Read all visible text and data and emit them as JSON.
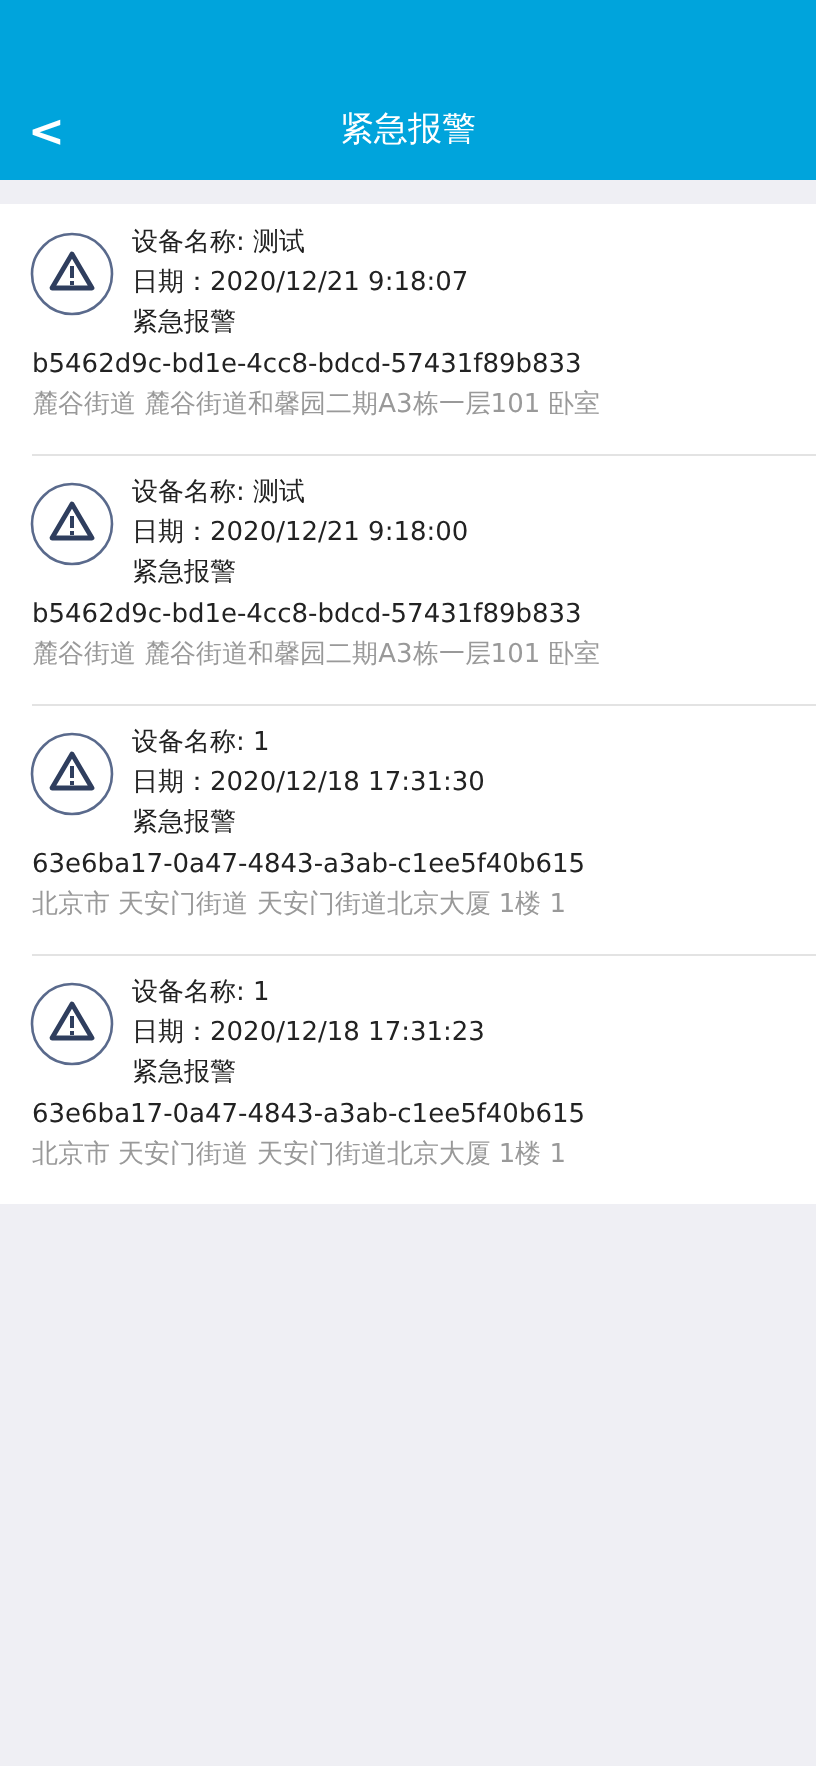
{
  "header": {
    "back": "<",
    "title": "紧急报警"
  },
  "alarms": [
    {
      "device": "设备名称: 测试",
      "date": "日期：2020/12/21 9:18:07",
      "type": "紧急报警",
      "id": "b5462d9c-bd1e-4cc8-bdcd-57431f89b833",
      "address": "麓谷街道 麓谷街道和馨园二期A3栋一层101 卧室"
    },
    {
      "device": "设备名称: 测试",
      "date": "日期：2020/12/21 9:18:00",
      "type": "紧急报警",
      "id": "b5462d9c-bd1e-4cc8-bdcd-57431f89b833",
      "address": "麓谷街道 麓谷街道和馨园二期A3栋一层101 卧室"
    },
    {
      "device": "设备名称: 1",
      "date": "日期：2020/12/18 17:31:30",
      "type": "紧急报警",
      "id": "63e6ba17-0a47-4843-a3ab-c1ee5f40b615",
      "address": "北京市 天安门街道 天安门街道北京大厦 1楼 1"
    },
    {
      "device": "设备名称: 1",
      "date": "日期：2020/12/18 17:31:23",
      "type": "紧急报警",
      "id": "63e6ba17-0a47-4843-a3ab-c1ee5f40b615",
      "address": "北京市 天安门街道 天安门街道北京大厦 1楼 1"
    }
  ]
}
